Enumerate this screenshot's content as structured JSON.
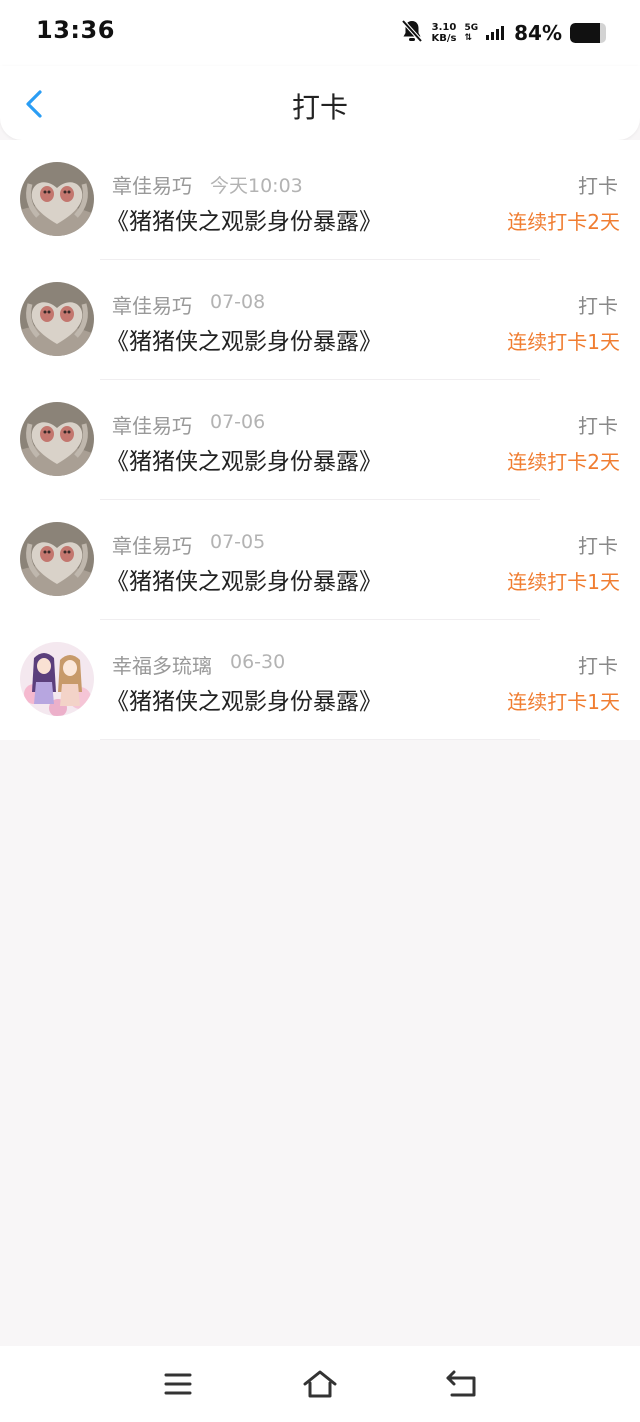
{
  "status_bar": {
    "time": "13:36",
    "net_speed_value": "3.10",
    "net_speed_unit": "KB/s",
    "network_type": "5G",
    "battery_percent": "84%",
    "battery_level": 0.84,
    "icons": [
      "bell-muted-icon",
      "signal-icon",
      "battery-icon"
    ]
  },
  "header": {
    "title": "打卡",
    "back_icon": "chevron-left-icon",
    "accent_color": "#2a9df4"
  },
  "checkins": [
    {
      "user": "章佳易巧",
      "time": "今天10:03",
      "title": "《猪猪侠之观影身份暴露》",
      "type": "打卡",
      "streak": "连续打卡2天",
      "avatar": "monkeys-avatar"
    },
    {
      "user": "章佳易巧",
      "time": "07-08",
      "title": "《猪猪侠之观影身份暴露》",
      "type": "打卡",
      "streak": "连续打卡1天",
      "avatar": "monkeys-avatar"
    },
    {
      "user": "章佳易巧",
      "time": "07-06",
      "title": "《猪猪侠之观影身份暴露》",
      "type": "打卡",
      "streak": "连续打卡2天",
      "avatar": "monkeys-avatar"
    },
    {
      "user": "章佳易巧",
      "time": "07-05",
      "title": "《猪猪侠之观影身份暴露》",
      "type": "打卡",
      "streak": "连续打卡1天",
      "avatar": "monkeys-avatar"
    },
    {
      "user": "幸福多琉璃",
      "time": "06-30",
      "title": "《猪猪侠之观影身份暴露》",
      "type": "打卡",
      "streak": "连续打卡1天",
      "avatar": "anime-girls-avatar"
    }
  ],
  "colors": {
    "streak": "#f07d31",
    "background": "#f8f6f7"
  },
  "nav_bar": {
    "icons": [
      "menu-icon",
      "home-icon",
      "back-icon"
    ]
  }
}
